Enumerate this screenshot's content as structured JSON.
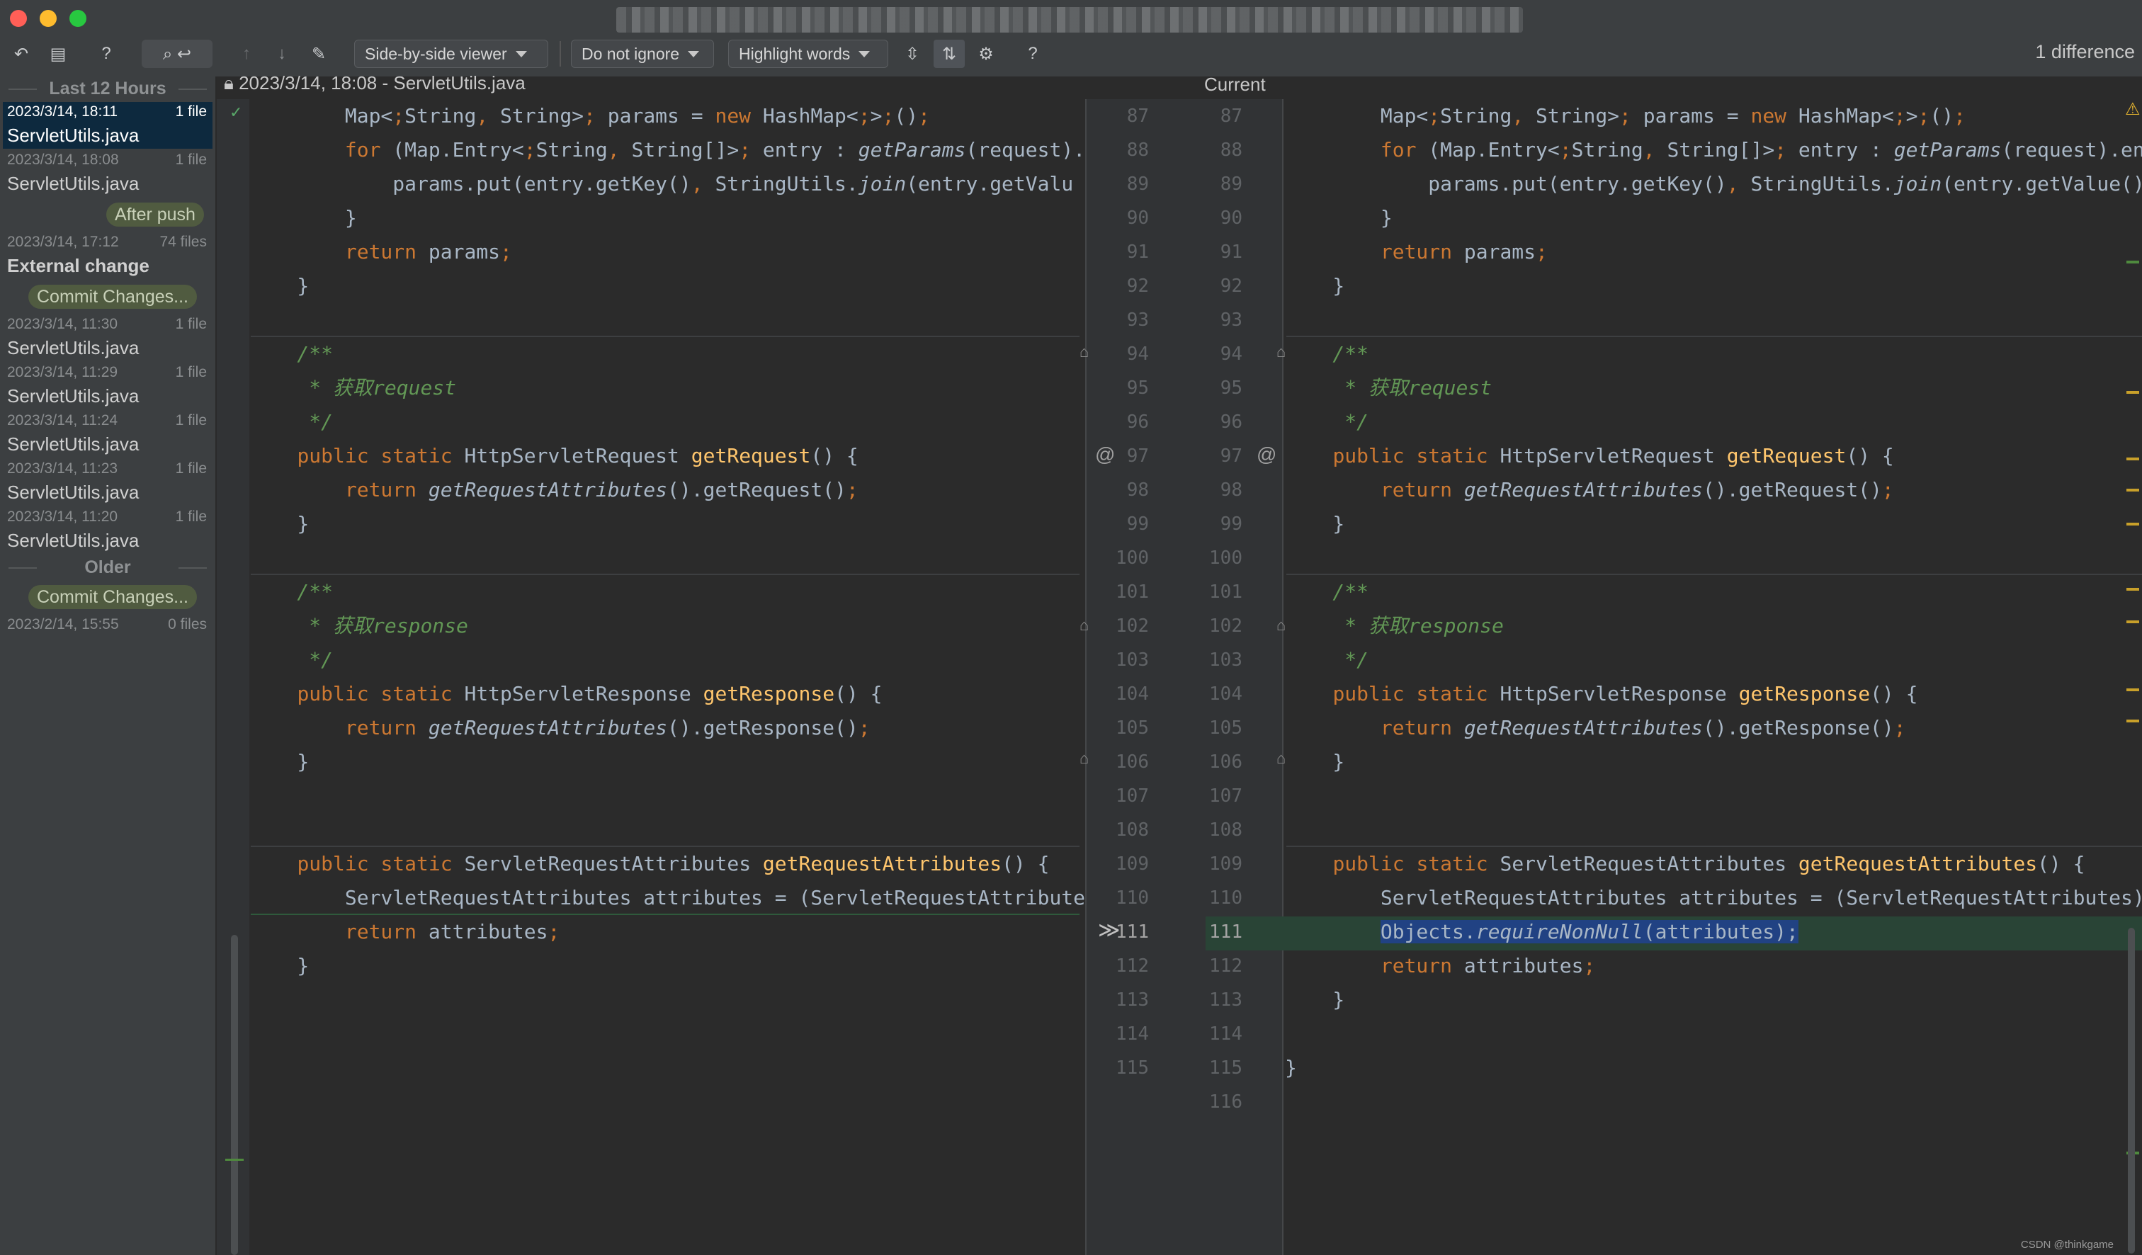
{
  "toolbar": {
    "viewer_label": "Side-by-side viewer",
    "ignore_label": "Do not ignore",
    "highlight_label": "Highlight words",
    "help_glyph": "?",
    "diff_count": "1 difference"
  },
  "sidebar": {
    "group_recent": "Last 12 Hours",
    "group_older": "Older",
    "items": [
      {
        "date": "2023/3/14, 18:11",
        "count": "1 file",
        "name": "ServletUtils.java"
      },
      {
        "date": "2023/3/14, 18:08",
        "count": "1 file",
        "name": "ServletUtils.java"
      },
      {
        "label": "After push"
      },
      {
        "date": "2023/3/14, 17:12",
        "count": "74 files",
        "name": "External change"
      },
      {
        "label": "Commit Changes..."
      },
      {
        "date": "2023/3/14, 11:30",
        "count": "1 file",
        "name": "ServletUtils.java"
      },
      {
        "date": "2023/3/14, 11:29",
        "count": "1 file",
        "name": "ServletUtils.java"
      },
      {
        "date": "2023/3/14, 11:24",
        "count": "1 file",
        "name": "ServletUtils.java"
      },
      {
        "date": "2023/3/14, 11:23",
        "count": "1 file",
        "name": "ServletUtils.java"
      },
      {
        "date": "2023/3/14, 11:20",
        "count": "1 file",
        "name": "ServletUtils.java"
      },
      {
        "label": "Commit Changes..."
      },
      {
        "date": "2023/2/14, 15:55",
        "count": "0 files"
      }
    ]
  },
  "editor": {
    "left_title": "2023/3/14, 18:08 - ServletUtils.java",
    "right_title": "Current",
    "left_lines": [
      "87",
      "88",
      "89",
      "90",
      "91",
      "92",
      "93",
      "94",
      "95",
      "96",
      "97",
      "98",
      "99",
      "100",
      "101",
      "102",
      "103",
      "104",
      "105",
      "106",
      "107",
      "108",
      "109",
      "110",
      "111",
      "112",
      "113",
      "114",
      "115"
    ],
    "right_lines": [
      "87",
      "88",
      "89",
      "90",
      "91",
      "92",
      "93",
      "94",
      "95",
      "96",
      "97",
      "98",
      "99",
      "100",
      "101",
      "102",
      "103",
      "104",
      "105",
      "106",
      "107",
      "108",
      "109",
      "110",
      "111",
      "112",
      "113",
      "114",
      "115",
      "116"
    ],
    "left_code": {
      "l87": "        Map<String, String> params = new HashMap<>();",
      "l88": "        for (Map.Entry<String, String[]> entry : getParams(request).e",
      "l89": "            params.put(entry.getKey(), StringUtils.join(entry.getValu",
      "l90": "        }",
      "l91": "        return params;",
      "l92": "    }",
      "l94": "    /**",
      "l95": "     * 获取request",
      "l96": "     */",
      "l97": "    public static HttpServletRequest getRequest() {",
      "l98": "        return getRequestAttributes().getRequest();",
      "l99": "    }",
      "l101": "    /**",
      "l102": "     * 获取response",
      "l103": "     */",
      "l104": "    public static HttpServletResponse getResponse() {",
      "l105": "        return getRequestAttributes().getResponse();",
      "l106": "    }",
      "l109": "    public static ServletRequestAttributes getRequestAttributes() {",
      "l110": "        ServletRequestAttributes attributes = (ServletRequestAttribute",
      "l111": "        return attributes;",
      "l112": "    }",
      "l114": "}"
    },
    "right_code": {
      "l87": "        Map<String, String> params = new HashMap<>();",
      "l88": "        for (Map.Entry<String, String[]> entry : getParams(request).entr",
      "l89": "            params.put(entry.getKey(), StringUtils.join(entry.getValue()",
      "l90": "        }",
      "l91": "        return params;",
      "l92": "    }",
      "l94": "    /**",
      "l95": "     * 获取request",
      "l96": "     */",
      "l97": "    public static HttpServletRequest getRequest() {",
      "l98": "        return getRequestAttributes().getRequest();",
      "l99": "    }",
      "l101": "    /**",
      "l102": "     * 获取response",
      "l103": "     */",
      "l104": "    public static HttpServletResponse getResponse() {",
      "l105": "        return getRequestAttributes().getResponse();",
      "l106": "    }",
      "l109": "    public static ServletRequestAttributes getRequestAttributes() {",
      "l110": "        ServletRequestAttributes attributes = (ServletRequestAttributes)",
      "l111": "        Objects.requireNonNull(attributes);",
      "l112": "        return attributes;",
      "l113": "    }",
      "l115": "}"
    },
    "at_glyph": "@",
    "arrow_glyph": "≫"
  },
  "watermark": "CSDN @thinkgame",
  "colors": {
    "accent_green": "#294436",
    "selection": "#214283",
    "keyword": "#cc7832",
    "function": "#ffc66d",
    "doc": "#629755"
  }
}
